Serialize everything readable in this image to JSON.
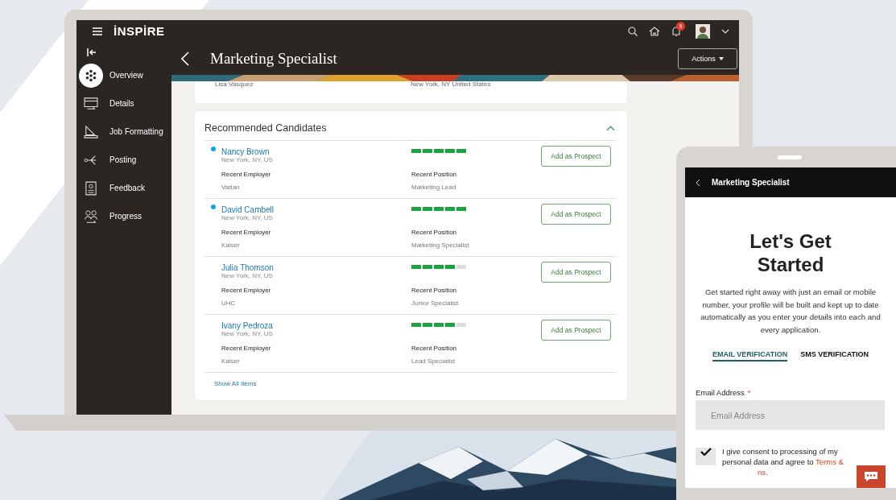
{
  "app": {
    "logo": "İNSPİRE",
    "notification_count": "9"
  },
  "page": {
    "title": "Marketing Specialist",
    "actions_label": "Actions"
  },
  "sidebar": {
    "items": [
      {
        "label": "Overview",
        "selected": true
      },
      {
        "label": "Details",
        "selected": false
      },
      {
        "label": "Job Formatting",
        "selected": false
      },
      {
        "label": "Posting",
        "selected": false
      },
      {
        "label": "Feedback",
        "selected": false
      },
      {
        "label": "Progress",
        "selected": false
      }
    ]
  },
  "previous_card": {
    "name": "Lisa Vasquez",
    "location": "New York, NY United States"
  },
  "candidates": {
    "title": "Recommended Candidates",
    "expanded": true,
    "show_all": "Show All Items",
    "rows": [
      {
        "name": "Nancy Brown",
        "location": "New York, NY, US",
        "new": true,
        "level": 1,
        "employer_label": "Recent Employer",
        "employer": "Varian",
        "position_label": "Recent Position",
        "position": "Marketing Lead",
        "button": "Add as Prospect"
      },
      {
        "name": "David Cambell",
        "location": "New York, NY, US",
        "new": true,
        "level": 1,
        "employer_label": "Recent Employer",
        "employer": "Kaiser",
        "position_label": "Recent Position",
        "position": "Marketing Specialist",
        "button": "Add as Prospect"
      },
      {
        "name": "Julia Thomson",
        "location": "New York, NY, US",
        "new": false,
        "level": 0.8,
        "employer_label": "Recent Employer",
        "employer": "UHC",
        "position_label": "Recent Position",
        "position": "Junior Specialist",
        "button": "Add as Prospect"
      },
      {
        "name": "Ivany Pedroza",
        "location": "New York, NY, US",
        "new": false,
        "level": 0.8,
        "employer_label": "Recent Employer",
        "employer": "Kaiser",
        "position_label": "Recent Position",
        "position": "Lead Specialist",
        "button": "Add as Prospect"
      }
    ]
  },
  "phone": {
    "title": "Marketing Specialist",
    "heading": "Let's Get Started",
    "intro": "Get started right away with just an email or mobile number, your profile will be built and kept up to date automatically as you enter your details into each and every application.",
    "tabs": [
      {
        "label": "EMAIL VERIFICATION",
        "selected": true
      },
      {
        "label": "SMS VERIFICATION",
        "selected": false
      }
    ],
    "email_label": "Email Address",
    "required_mark": "*",
    "email_placeholder": "Email Address",
    "consent": {
      "checked": true,
      "text": "I give consent to processing of my personal data and agree to",
      "link": "Terms &",
      "link_tail": "ns."
    }
  }
}
